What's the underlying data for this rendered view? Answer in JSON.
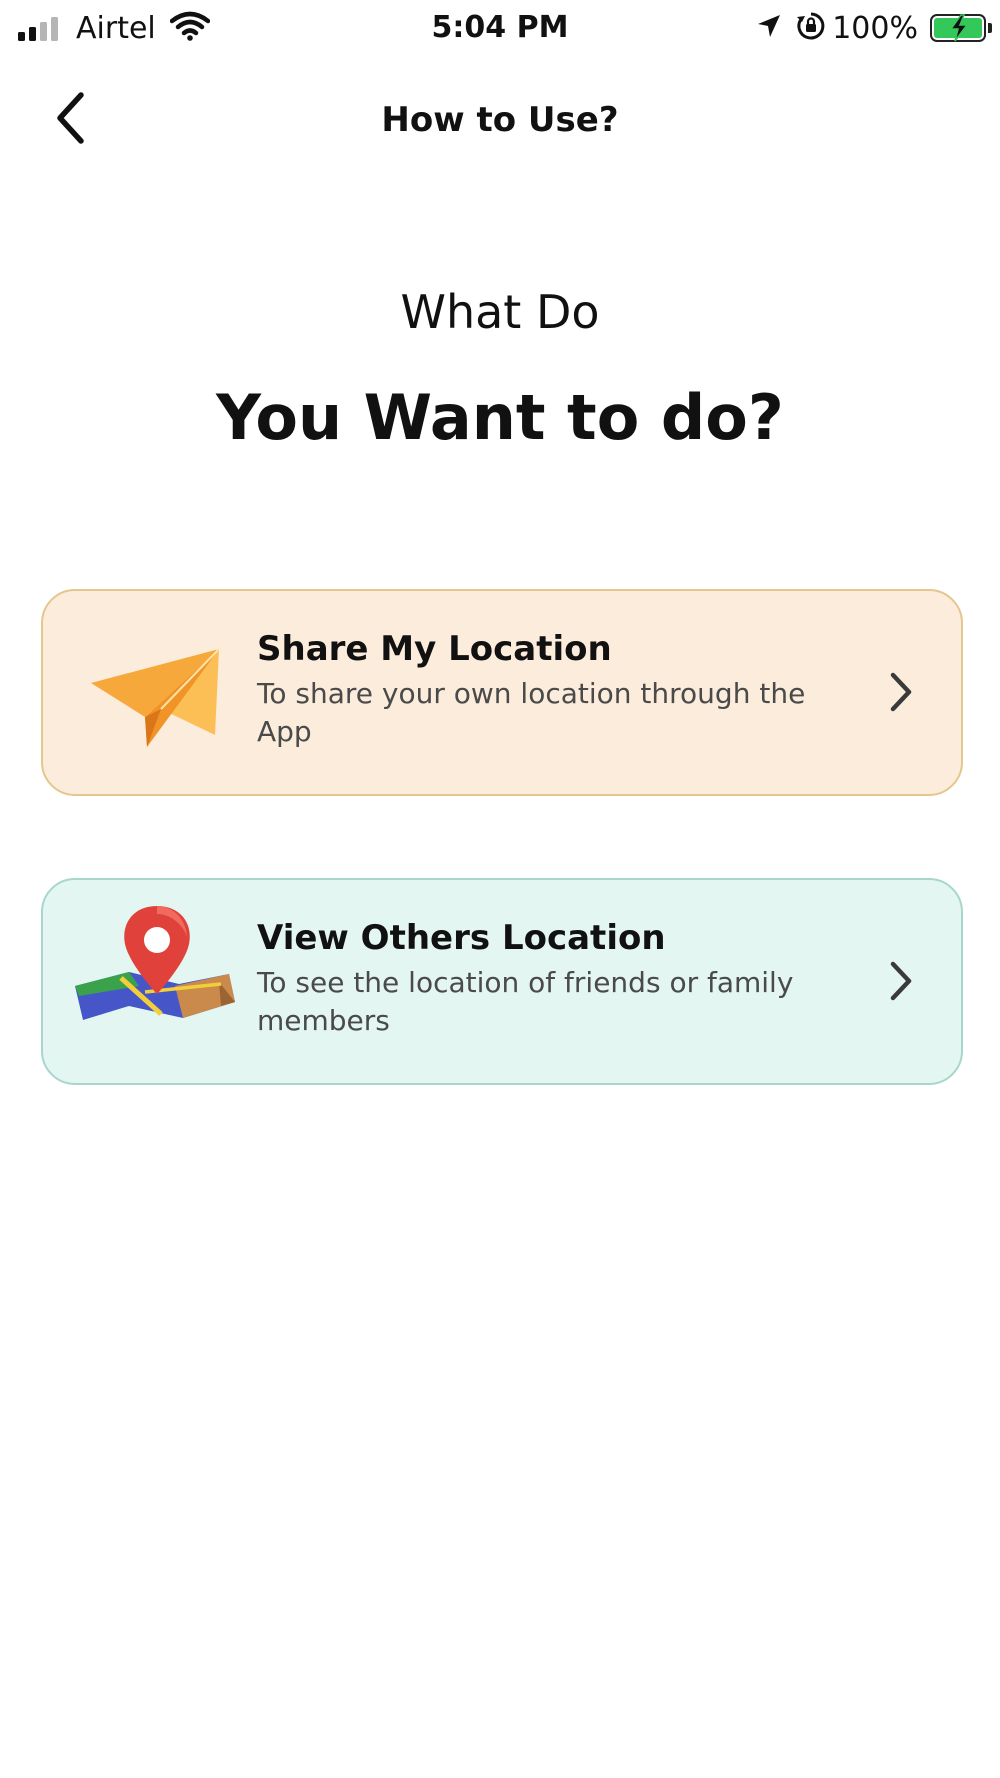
{
  "status_bar": {
    "carrier": "Airtel",
    "time": "5:04 PM",
    "battery_percent": "100%",
    "icons": [
      "signal-icon",
      "wifi-icon",
      "location-arrow-icon",
      "rotation-lock-icon",
      "battery-charging-icon"
    ]
  },
  "nav": {
    "title": "How to Use?",
    "back_icon": "chevron-left-icon"
  },
  "heading": {
    "line1": "What Do",
    "line2": "You Want to do?"
  },
  "options": [
    {
      "title": "Share My Location",
      "description": "To share your own location through the App",
      "icon": "paper-plane-icon",
      "background": "#fcecdc",
      "border": "#e6c68f"
    },
    {
      "title": "View Others Location",
      "description": "To see the location of friends or family members",
      "icon": "map-pin-icon",
      "background": "#e3f6f2",
      "border": "#a9d6cc"
    }
  ],
  "colors": {
    "battery_fill": "#34c759"
  }
}
